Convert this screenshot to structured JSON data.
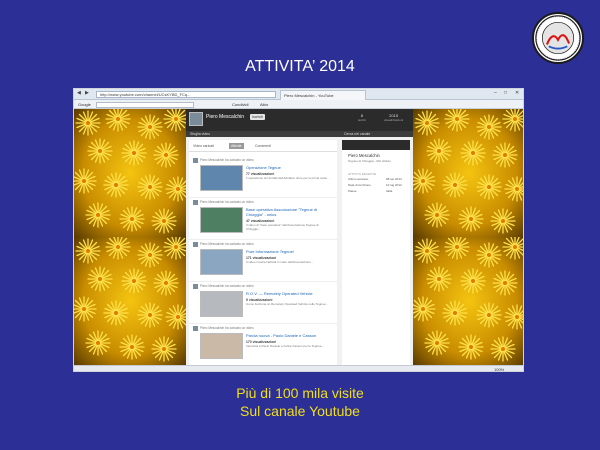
{
  "slide": {
    "title": "ATTIVITA’ 2014",
    "caption_line1": "Più di 100 mila visite",
    "caption_line2": "Sul canale Youtube"
  },
  "browser": {
    "address": "http://www.youtube.com/channel/UCsKYBD_FCq...",
    "tabs": [
      "Piero Mescalchin - YouTube"
    ],
    "google_label": "Google",
    "favorites": [
      "Condividi",
      "Altro"
    ],
    "zoom": "100%"
  },
  "youtube": {
    "channel_name": "Piero Mescalchin",
    "subscribe_label": "Iscriviti",
    "stats": [
      {
        "value": "8",
        "label": "iscritti"
      },
      {
        "value": "2015",
        "label": "visualizzazioni"
      }
    ],
    "nav": [
      "Sfoglia video",
      "Cerca nel canale"
    ],
    "tabs": [
      "Video caricati",
      "Attività",
      "Commenti"
    ],
    "feed": [
      {
        "user_line": "Piero Mescalchin ha caricato un video",
        "title": "Operazione Tegnue",
        "views": "77 visualizzazioni",
        "desc": "L'operazione sui fondali dell'Adriatico dove per la prima volta..."
      },
      {
        "user_line": "Piero Mescalchin ha caricato un video",
        "title": "Base operativa Associazione \"Tegnue di Chioggia\" - onlus",
        "views": "47 visualizzazioni",
        "desc": "Il video di \"base operativa\" dell'Associazione Tegnue di Chioggia..."
      },
      {
        "user_line": "Piero Mescalchin ha caricato un video",
        "title": "Pure Informazione Tegnue!",
        "views": "171 visualizzazioni",
        "desc": "Il video mostra l'attività in mare dell'Associazione..."
      },
      {
        "user_line": "Piero Mescalchin ha caricato un video",
        "title": "R.O.V. — Remotely Operated Vehicle",
        "views": "9 visualizzazioni",
        "desc": "Come funziona un Remotely Operated Vehicle nelle Tegnue..."
      },
      {
        "user_line": "Piero Mescalchin ha caricato un video",
        "title": "Parola nuova - Paolo Daniele e Casson",
        "views": "170 visualizzazioni",
        "desc": "Intervista a Paolo Daniele e Felice Casson per le Tegnue..."
      }
    ],
    "sidebar": {
      "name": "Piero Mescalchin",
      "desc": "Tegnue di Chioggia - Mio Istituto",
      "section": "ATTIVITÀ RECENTE",
      "rows": [
        {
          "k": "Ultimo accesso",
          "v": "08 set 2014"
        },
        {
          "k": "Data di iscrizione",
          "v": "10 lug 2012"
        },
        {
          "k": "Paese",
          "v": "Italia"
        }
      ]
    }
  },
  "colors": {
    "slide_bg": "#2b2f96",
    "caption": "#f2df18",
    "title": "#ffffff"
  },
  "icons": [
    "association-logo-icon",
    "yellow-coral-image"
  ]
}
